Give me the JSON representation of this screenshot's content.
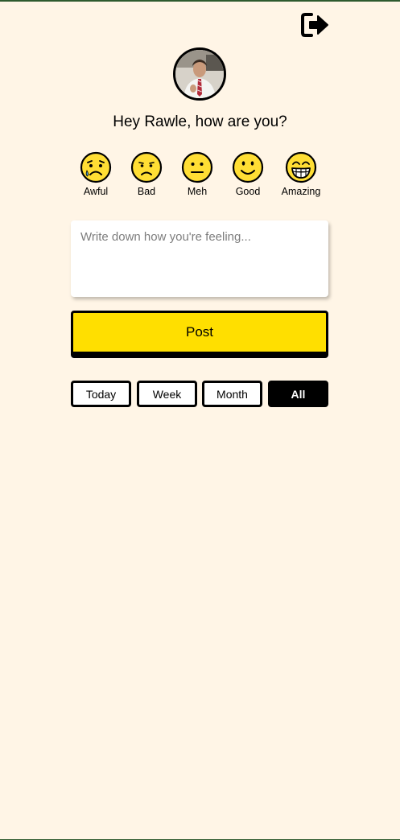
{
  "header": {
    "logout_icon": "logout-icon"
  },
  "profile": {
    "avatar_icon": "user-photo"
  },
  "greeting": "Hey Rawle, how are you?",
  "moods": [
    {
      "label": "Awful",
      "icon": "crying-face-icon"
    },
    {
      "label": "Bad",
      "icon": "frowning-face-icon"
    },
    {
      "label": "Meh",
      "icon": "neutral-face-icon"
    },
    {
      "label": "Good",
      "icon": "smiling-face-icon"
    },
    {
      "label": "Amazing",
      "icon": "grinning-face-icon"
    }
  ],
  "journal": {
    "placeholder": "Write down how you're feeling...",
    "value": ""
  },
  "post_label": "Post",
  "filters": {
    "options": [
      "Today",
      "Week",
      "Month",
      "All"
    ],
    "selected": "All"
  },
  "colors": {
    "background": "#fff5e6",
    "accent_yellow": "#ffdf00",
    "emoji_yellow": "#ffde34",
    "black": "#000000"
  }
}
